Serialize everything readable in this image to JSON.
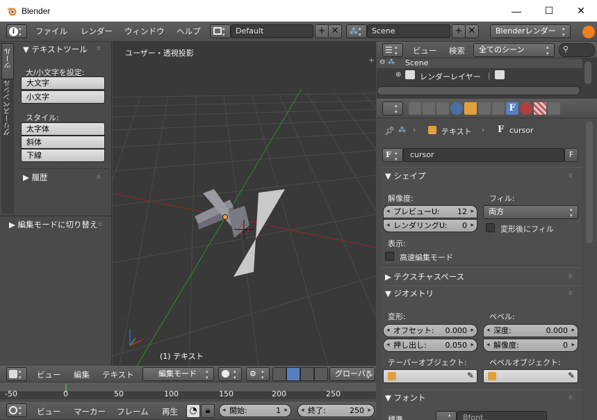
{
  "window": {
    "title": "Blender",
    "minimize": "—",
    "maximize": "☐",
    "close": "✕"
  },
  "topbar": {
    "menus": [
      "ファイル",
      "レンダー",
      "ウィンドウ",
      "ヘルプ"
    ],
    "screen_layout": "Default",
    "scene": "Scene",
    "render_engine": "Blenderレンダー"
  },
  "toolshelf": {
    "tabs": [
      "ツール",
      "グリースペンシル"
    ],
    "panel_title": "テキストツール",
    "case_label": "大/小文字を設定:",
    "upper": "大文字",
    "lower": "小文字",
    "style_label": "スタイル:",
    "bold": "太字体",
    "italic": "斜体",
    "underline": "下線",
    "history": "履歴",
    "operator_panel": "編集モードに切り替え"
  },
  "viewport": {
    "view_name": "ユーザー・透視投影",
    "object_label": "(1) テキスト",
    "header": {
      "view": "ビュー",
      "select": "編集",
      "text": "テキスト",
      "mode": "編集モード",
      "orientation": "グローバル"
    }
  },
  "timeline": {
    "ruler": [
      "-50",
      "0",
      "50",
      "100",
      "150",
      "200",
      "250"
    ],
    "menus": [
      "ビュー",
      "マーカー",
      "フレーム",
      "再生"
    ],
    "start_label": "開始:",
    "start_value": "1",
    "end_label": "終了:",
    "end_value": "250"
  },
  "outliner": {
    "view": "ビュー",
    "search": "検索",
    "filter": "全てのシーン",
    "scene": "Scene",
    "render_layers": "レンダーレイヤー"
  },
  "properties": {
    "breadcrumb": {
      "object": "テキスト",
      "data": "cursor"
    },
    "datablock": "cursor",
    "datablock_flag": "F",
    "shape": {
      "title": "シェイプ",
      "resolution_label": "解像度:",
      "preview_u_label": "プレビューU:",
      "preview_u_value": "12",
      "render_u_label": "レンダリングU:",
      "render_u_value": "0",
      "fill_label": "フィル:",
      "fill_value": "両方",
      "fill_deform": "変形後にフィル",
      "display_label": "表示:",
      "fast_edit": "高速編集モード"
    },
    "texture_space": {
      "title": "テクスチャスペース"
    },
    "geometry": {
      "title": "ジオメトリ",
      "modification_label": "変形:",
      "offset_label": "オフセット:",
      "offset_value": "0.000",
      "extrude_label": "押し出し:",
      "extrude_value": "0.050",
      "bevel_label": "ベベル:",
      "depth_label": "深度:",
      "depth_value": "0.000",
      "resolution_label": "解像度:",
      "resolution_value": "0",
      "taper_label": "テーパーオブジェクト:",
      "bevel_obj_label": "ベベルオブジェクト:"
    },
    "font": {
      "title": "フォント",
      "regular_label": "標準",
      "font_name": "Bfont"
    }
  },
  "colors": {
    "selected_tab": "#5680c2",
    "x_axis": "#9b2b2b",
    "y_axis": "#3e8a2c",
    "grid": "#4a4a4a"
  }
}
